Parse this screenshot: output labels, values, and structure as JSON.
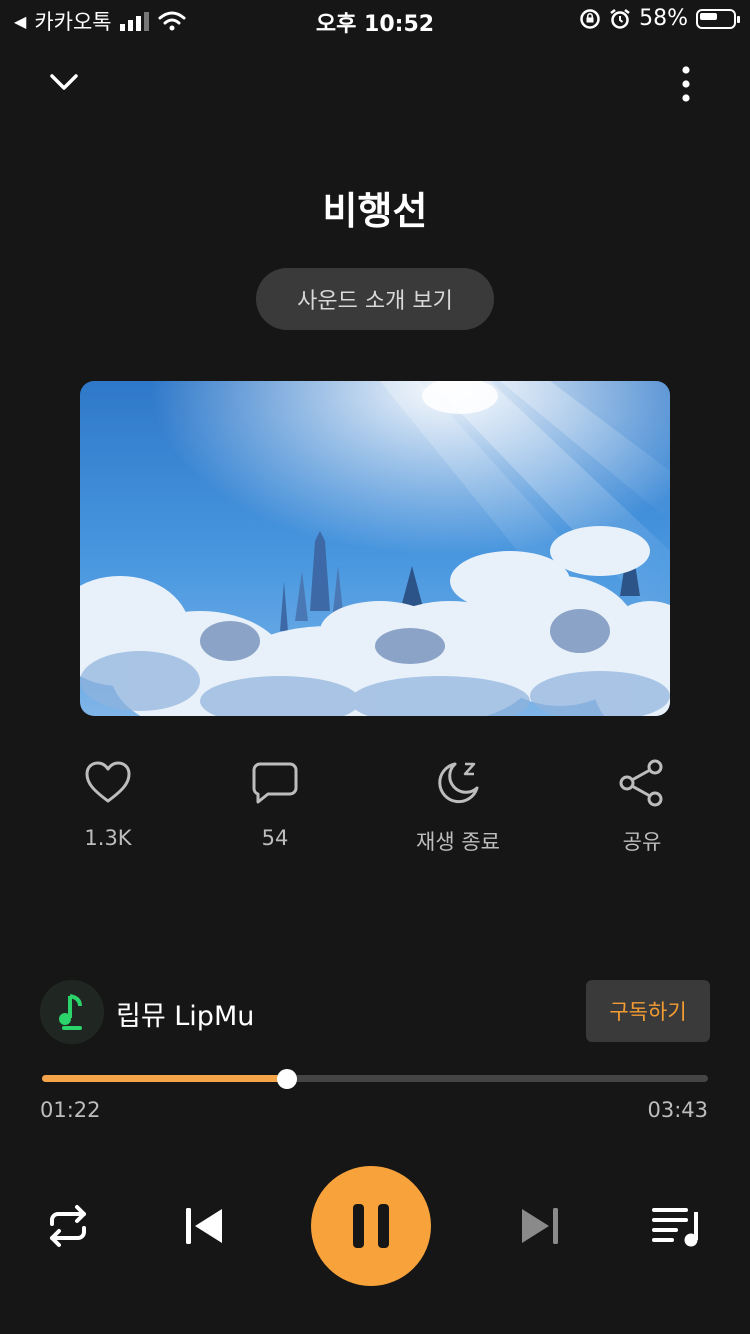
{
  "status_bar": {
    "back_app": "카카오톡",
    "time": "오후 10:52",
    "battery": "58%",
    "battery_level": 0.58
  },
  "header": {
    "collapse_icon": "chevron-down-icon",
    "menu_icon": "more-vertical-icon"
  },
  "track": {
    "title": "비행선",
    "intro_label": "사운드 소개 보기"
  },
  "actions": {
    "like": {
      "icon": "heart-icon",
      "label": "1.3K"
    },
    "comment": {
      "icon": "comment-icon",
      "label": "54"
    },
    "sleep": {
      "icon": "moon-icon",
      "label": "재생 종료"
    },
    "share": {
      "icon": "share-icon",
      "label": "공유"
    }
  },
  "channel": {
    "name": "립뮤 LipMu",
    "subscribe_label": "구독하기"
  },
  "progress": {
    "current": "01:22",
    "total": "03:43",
    "fraction": 0.368
  },
  "colors": {
    "accent": "#f7a23b",
    "background": "#161616"
  }
}
